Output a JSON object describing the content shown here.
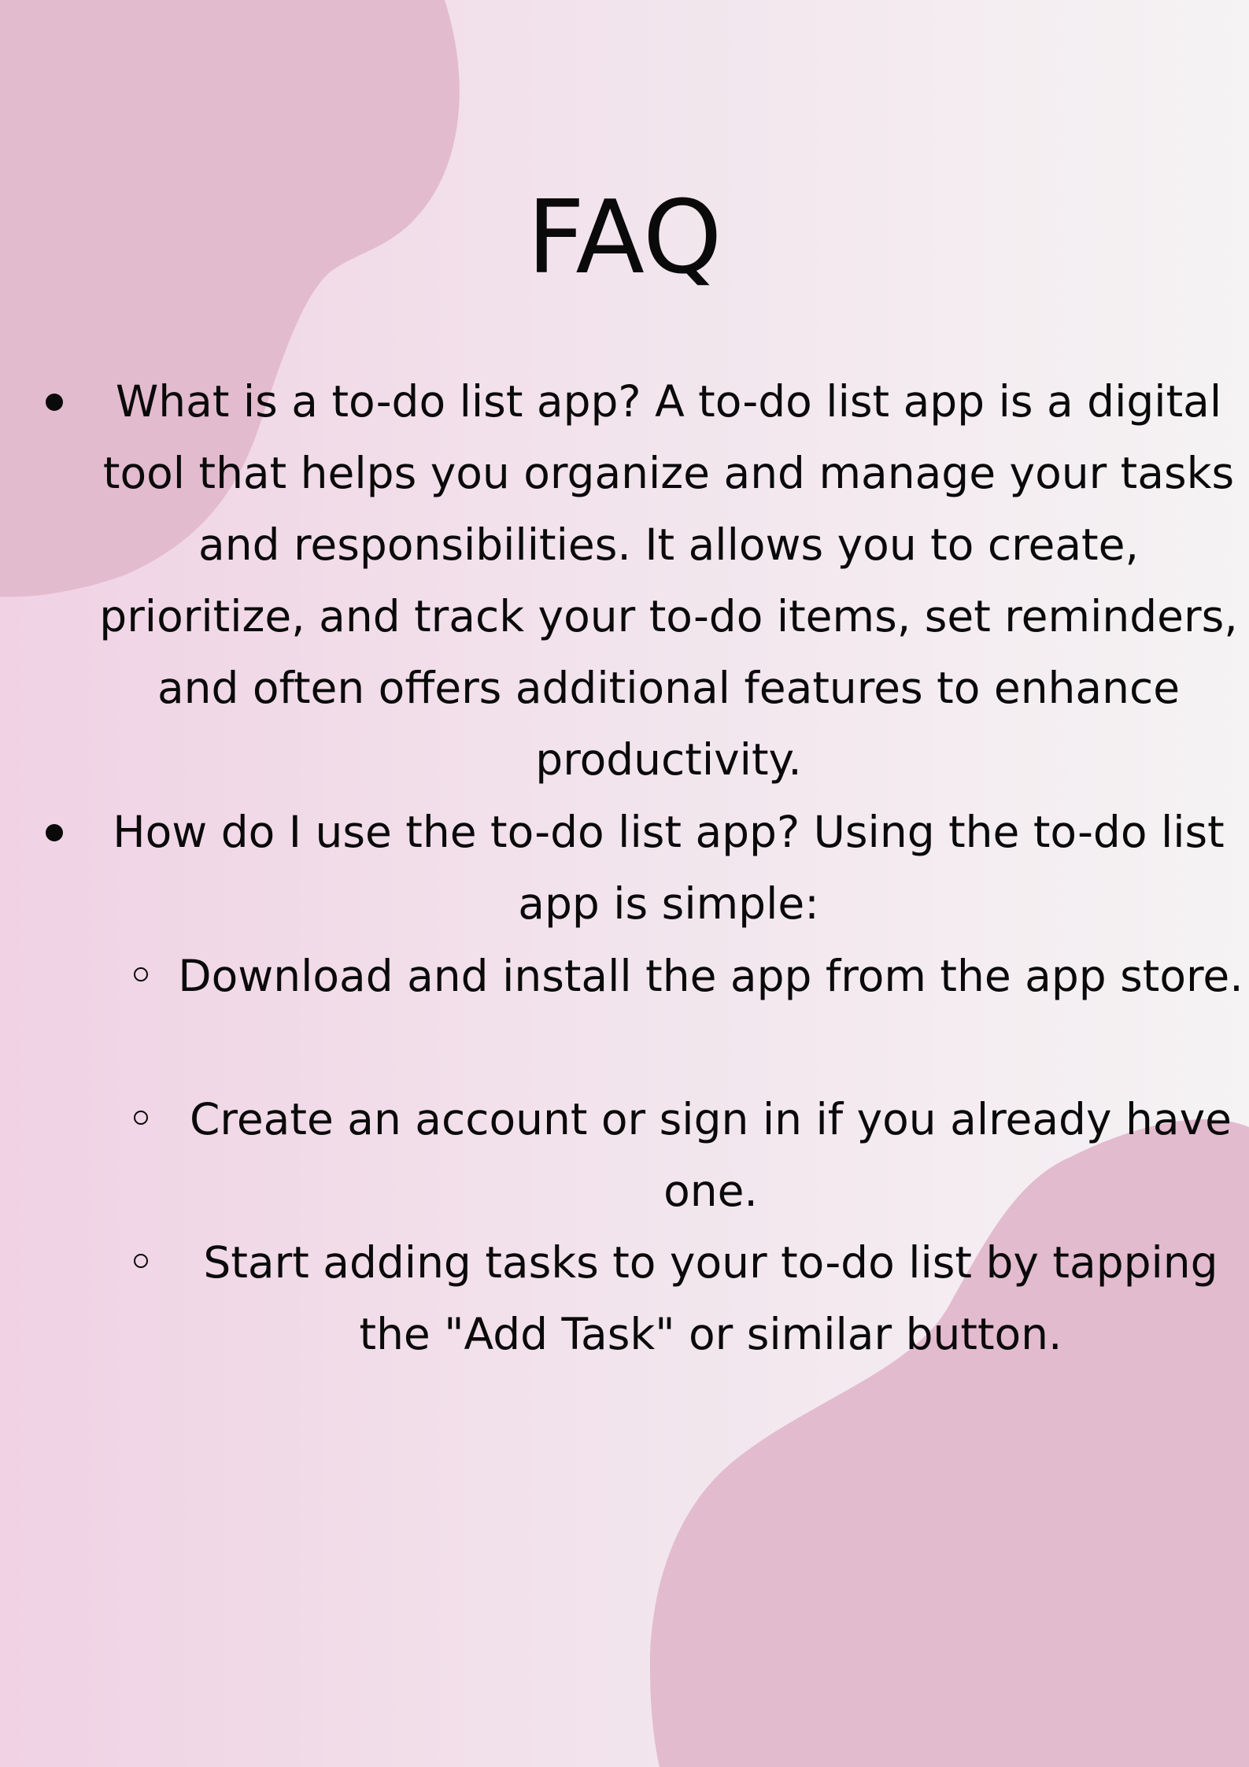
{
  "colors": {
    "blob": "#e3bbce",
    "text": "#0a0a0a"
  },
  "page": {
    "title": "FAQ",
    "items": [
      {
        "text": "What is a to-do list app? A to-do list app is a digital tool that helps you organize and manage your tasks and responsibilities. It allows you to create, prioritize, and track your to-do items, set reminders, and often offers additional features to enhance productivity."
      },
      {
        "text": "How do I use the to-do list app? Using the to-do list app is simple:"
      }
    ],
    "steps": [
      {
        "text": "Download and install the app from the app store."
      },
      {
        "text": "Create an account or sign in if you already have one."
      },
      {
        "text": "Start adding tasks to your to-do list by tapping the \"Add Task\" or similar button."
      }
    ]
  }
}
